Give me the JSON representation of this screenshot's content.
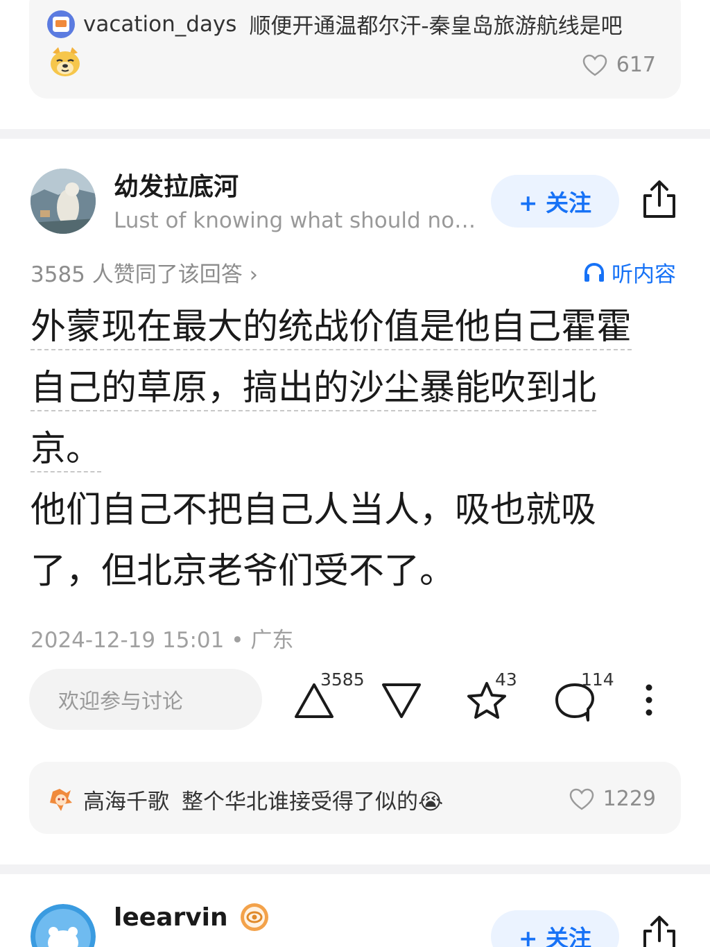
{
  "top_comment": {
    "username": "vacation_days",
    "text": "顺便开通温都尔汗-秦皇岛旅游航线是吧",
    "emoji": "doge-emoji",
    "likes": "617"
  },
  "answer": {
    "author_name": "幼发拉底河",
    "author_bio": "Lust of knowing what should not be known",
    "follow_label": "+ 关注",
    "approvals_text": "3585 人赞同了该回答 ›",
    "listen_label": "听内容",
    "paragraph1_lines": [
      "外蒙现在最大的统战价值是他自己霍霍",
      "自己的草原，搞出的沙尘暴能吹到北",
      "京。"
    ],
    "paragraph2_lines": [
      "他们自己不把自己人当人，吸也就吸",
      "了，但北京老爷们受不了。"
    ],
    "timestamp": "2024-12-19 15:01 • 广东",
    "discuss_placeholder": "欢迎参与讨论",
    "upvotes": "3585",
    "favorites": "43",
    "comments": "114"
  },
  "featured_comment": {
    "username": "高海千歌",
    "text": "整个华北谁接受得了似的😭",
    "likes": "1229"
  },
  "next_answer": {
    "author_name": "leearvin",
    "follow_label": "+ 关注"
  },
  "colors": {
    "accent": "#1772f6",
    "follow_bg": "#ebf3ff",
    "muted_text": "#8c8c8c",
    "card_bg": "#f6f6f6"
  }
}
